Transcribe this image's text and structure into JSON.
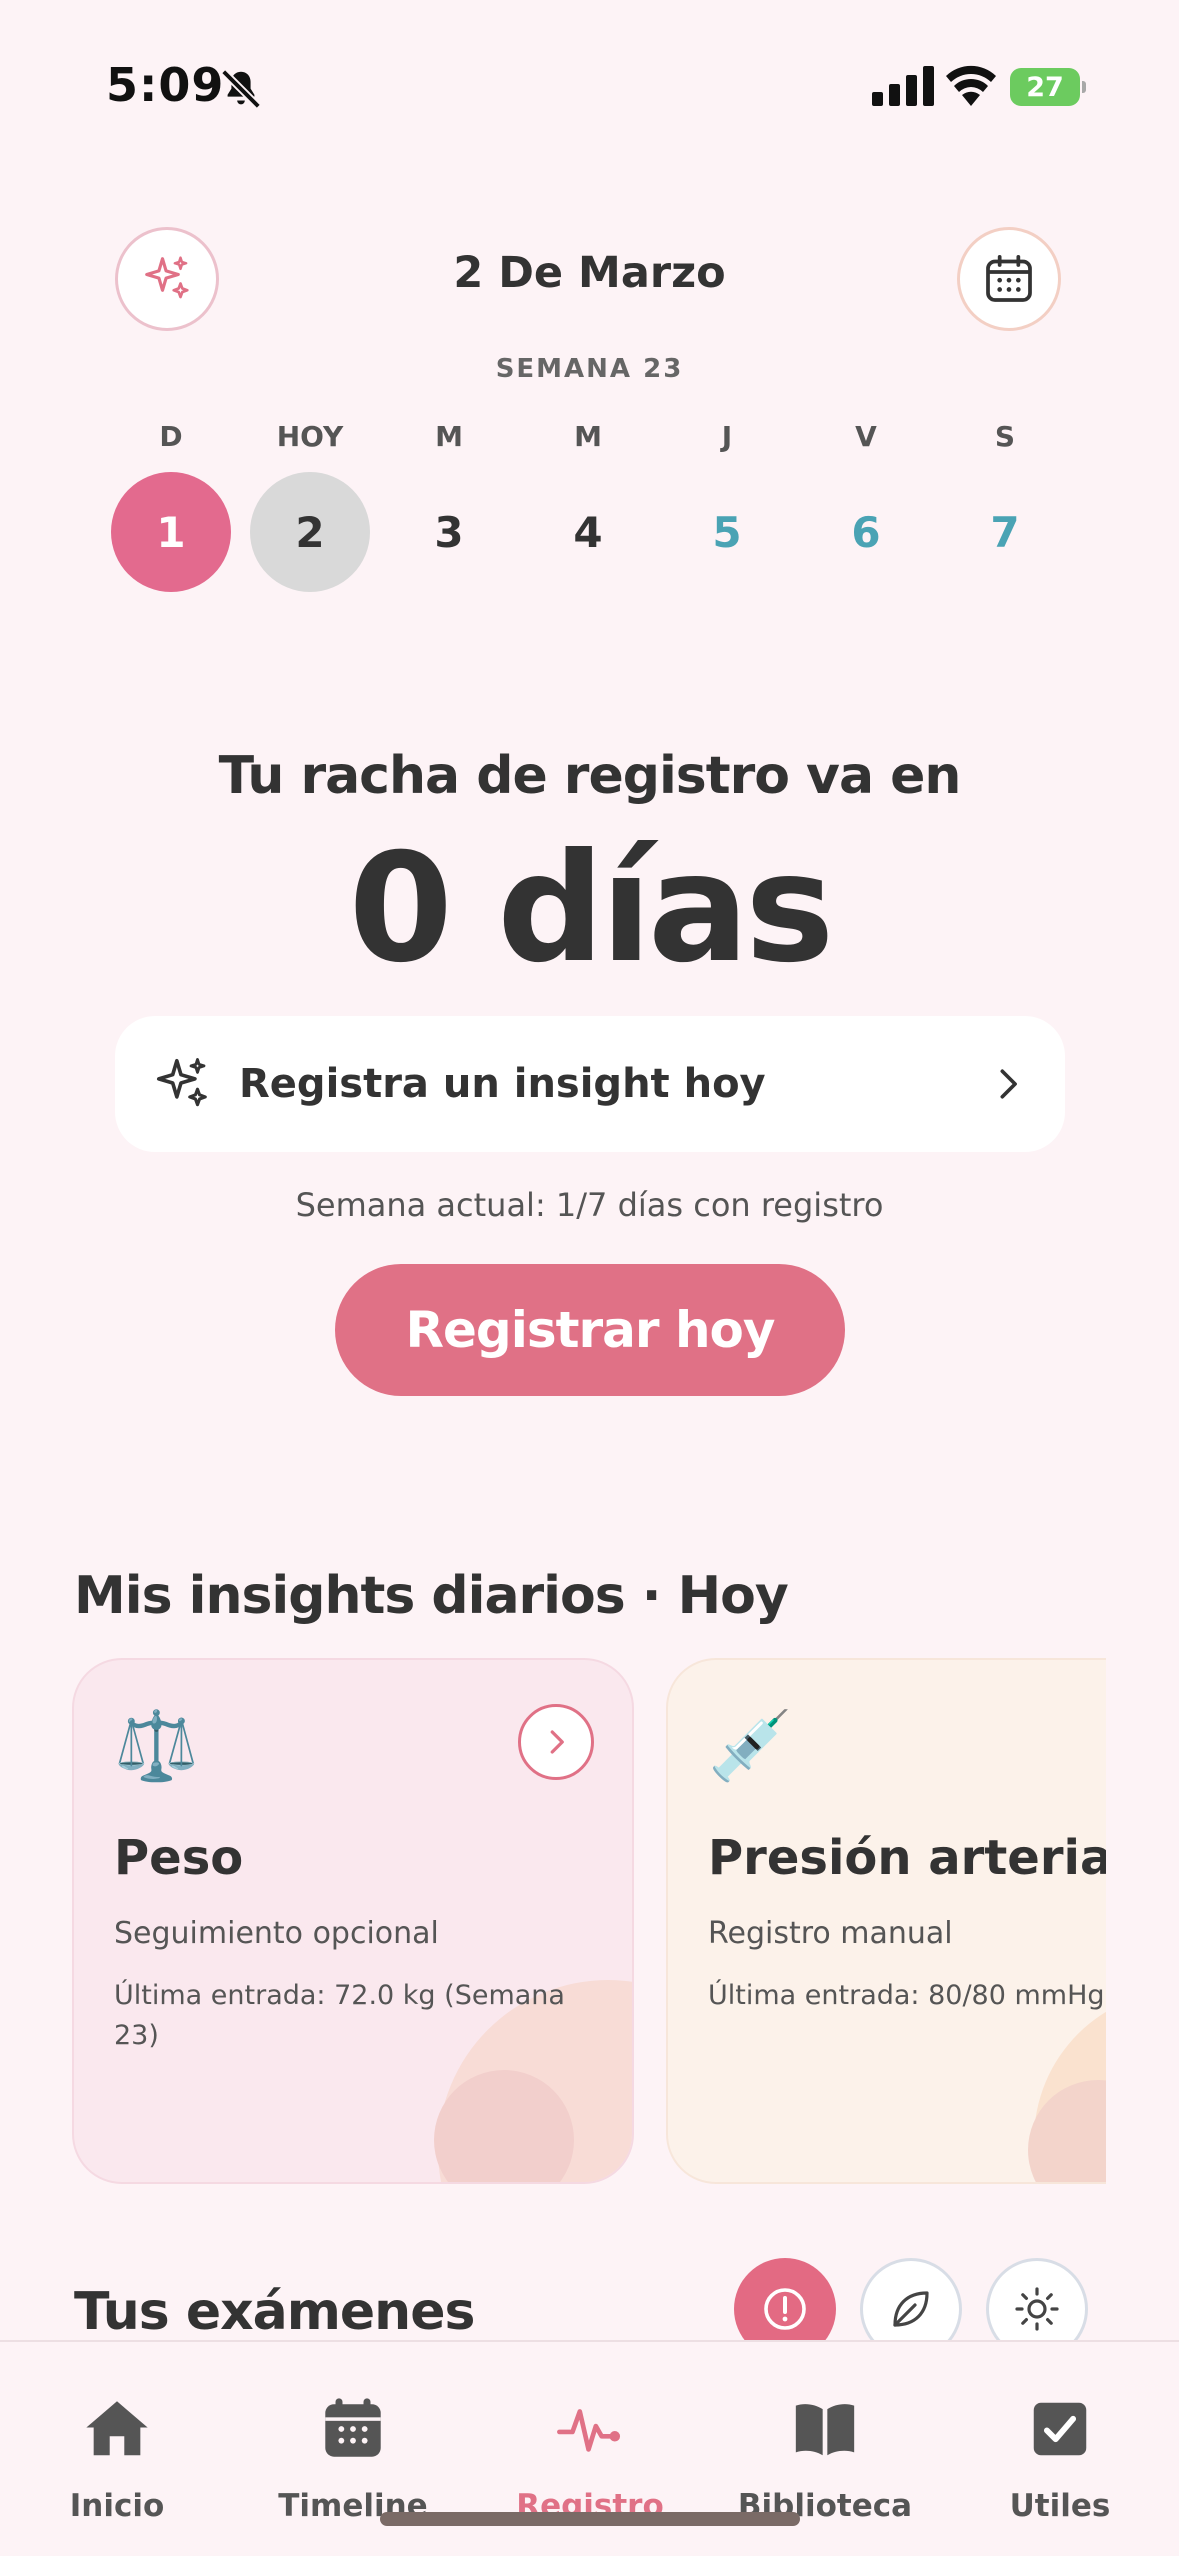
{
  "status_bar": {
    "time": "5:09",
    "battery": "27",
    "icons": [
      "bell-slash-icon",
      "cellular-signal-icon",
      "wifi-icon",
      "battery-charging-icon"
    ]
  },
  "header": {
    "date": "2 De Marzo",
    "week": "SEMANA 23",
    "left_icon": "sparkles-icon",
    "right_icon": "calendar-icon"
  },
  "week_days": [
    {
      "letter": "D",
      "number": "1",
      "state": "selected"
    },
    {
      "letter": "HOY",
      "number": "2",
      "state": "today"
    },
    {
      "letter": "M",
      "number": "3",
      "state": "past"
    },
    {
      "letter": "M",
      "number": "4",
      "state": "past"
    },
    {
      "letter": "J",
      "number": "5",
      "state": "future"
    },
    {
      "letter": "V",
      "number": "6",
      "state": "future"
    },
    {
      "letter": "S",
      "number": "7",
      "state": "future"
    }
  ],
  "streak": {
    "line": "Tu racha de registro va en",
    "count": "0 días"
  },
  "insight_prompt": {
    "label": "Registra un insight hoy"
  },
  "week_progress": "Semana actual: 1/7 días con registro",
  "register_button": "Registrar hoy",
  "insights_section": {
    "title": "Mis insights diarios · Hoy",
    "cards": [
      {
        "emoji": "⚖️",
        "title": "Peso",
        "subtitle": "Seguimiento opcional",
        "last_entry": "Última entrada: 72.0 kg (Semana 23)"
      },
      {
        "emoji": "💉",
        "title": "Presión arterial",
        "subtitle": "Registro manual",
        "last_entry": "Última entrada: 80/80 mmHg"
      }
    ]
  },
  "exams_section": {
    "title": "Tus exámenes",
    "filters": [
      "alert-icon",
      "leaf-icon",
      "sun-icon"
    ]
  },
  "tab_bar": {
    "tabs": [
      {
        "label": "Inicio",
        "icon": "house-icon"
      },
      {
        "label": "Timeline",
        "icon": "calendar-icon"
      },
      {
        "label": "Registro",
        "icon": "heartbeat-icon"
      },
      {
        "label": "Biblioteca",
        "icon": "book-icon"
      },
      {
        "label": "Utiles",
        "icon": "checkbox-icon"
      }
    ],
    "active_index": 2
  },
  "colors": {
    "background": "#fdf3f6",
    "accent_pink": "#e07186",
    "selected_day": "#e36a8e",
    "today_gray": "#d9d9d9",
    "future_teal": "#4aa3b4",
    "text_dark": "#333333"
  }
}
